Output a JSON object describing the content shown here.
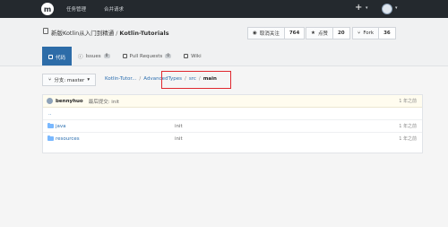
{
  "topbar": {
    "logo_text": "m",
    "nav": [
      "任务管理",
      "合并请求"
    ],
    "plus_label": "+"
  },
  "repo": {
    "owner": "新版Kotlin从入门到精通",
    "separator": "/",
    "name": "Kotlin-Tutorials",
    "stats": [
      {
        "label": "取消关注",
        "count": "764",
        "icon": "eye-icon"
      },
      {
        "label": "点赞",
        "count": "20",
        "icon": "star-icon"
      },
      {
        "label": "Fork",
        "count": "36",
        "icon": "fork-icon"
      }
    ]
  },
  "tabs": [
    {
      "label": "代码",
      "badge": ""
    },
    {
      "label": "Issues",
      "badge": "0"
    },
    {
      "label": "Pull Requests",
      "badge": "0"
    },
    {
      "label": "Wiki",
      "badge": ""
    }
  ],
  "toolbar": {
    "branch_label": "分支: master",
    "crumbs": [
      "Kotlin-Tutor...",
      "AdvancedTypes",
      "src"
    ],
    "current": "main"
  },
  "commit": {
    "user": "bennyhuo",
    "message": "最后提交: init",
    "time": "1 年之前"
  },
  "files": [
    {
      "name": "java",
      "message": "init",
      "time": "1 年之前"
    },
    {
      "name": "resources",
      "message": "init",
      "time": "1 年之前"
    }
  ],
  "up_label": ".."
}
